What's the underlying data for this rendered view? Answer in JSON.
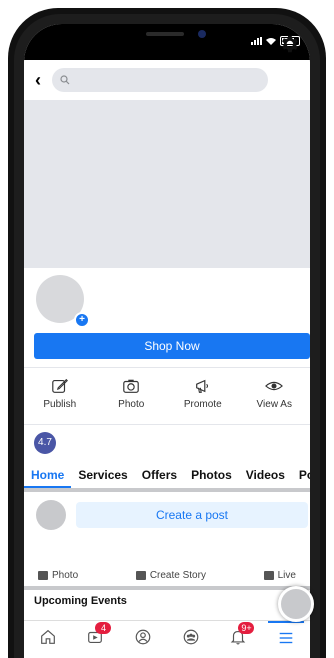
{
  "search": {
    "placeholder": ""
  },
  "page_actions": {
    "shop_now": "Shop Now"
  },
  "quick_actions": [
    {
      "label": "Publish",
      "icon": "edit-icon"
    },
    {
      "label": "Photo",
      "icon": "camera-icon"
    },
    {
      "label": "Promote",
      "icon": "megaphone-icon"
    },
    {
      "label": "View As",
      "icon": "eye-icon"
    }
  ],
  "rating": "4.7",
  "tabs": [
    "Home",
    "Services",
    "Offers",
    "Photos",
    "Videos",
    "Post"
  ],
  "composer": {
    "create_post": "Create a post"
  },
  "composer_actions": [
    {
      "label": "Photo",
      "icon": "photo-icon"
    },
    {
      "label": "Create Story",
      "icon": "story-icon"
    },
    {
      "label": "Live",
      "icon": "live-icon"
    }
  ],
  "sections": {
    "upcoming_events": "Upcoming Events"
  },
  "nav": {
    "items": [
      {
        "icon": "home-icon",
        "badge": ""
      },
      {
        "icon": "video-icon",
        "badge": "4"
      },
      {
        "icon": "profile-icon",
        "badge": ""
      },
      {
        "icon": "groups-icon",
        "badge": ""
      },
      {
        "icon": "bell-icon",
        "badge": "9+"
      },
      {
        "icon": "menu-icon",
        "badge": ""
      }
    ]
  },
  "colors": {
    "accent": "#1877f2",
    "badge": "#e41e3f",
    "rating_bg": "#4a56a6"
  }
}
